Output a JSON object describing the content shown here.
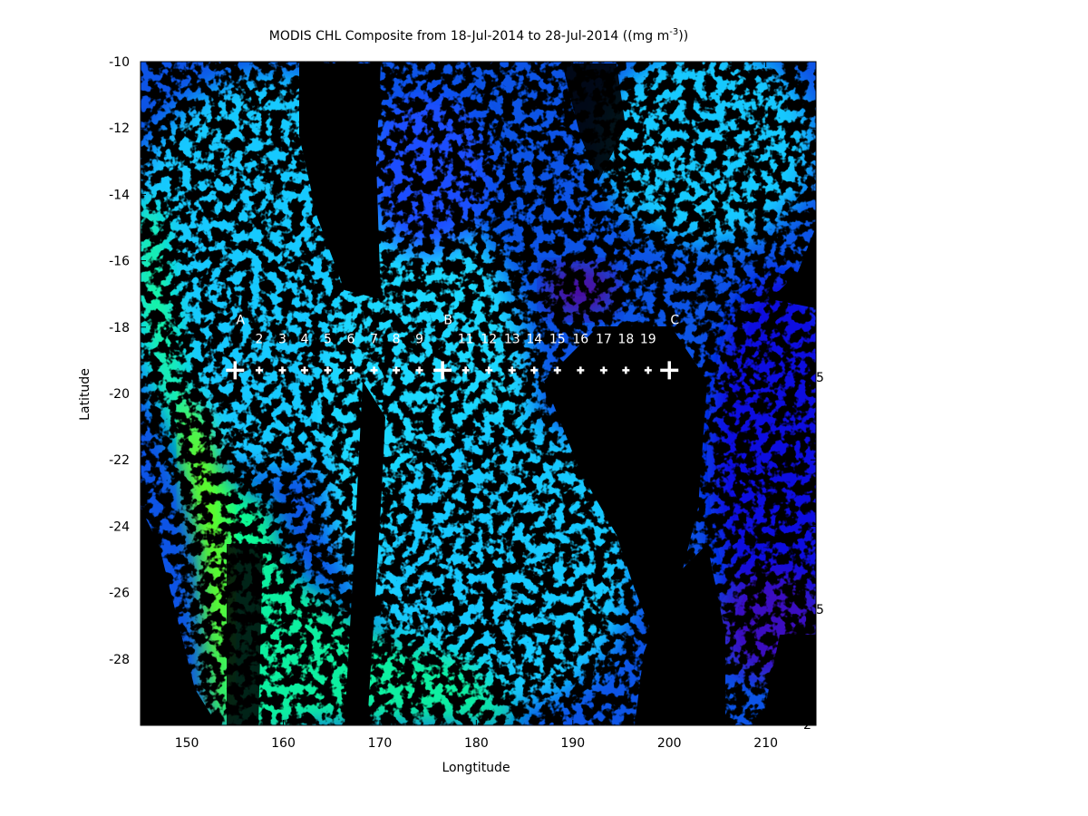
{
  "chart_data": {
    "type": "heatmap",
    "title_main": "MODIS CHL Composite from 18-Jul-2014 to 28-Jul-2014 ((mg m",
    "title_sup": "-3",
    "title_end": "))",
    "xlabel": "Longtitude",
    "ylabel": "Latitude",
    "xlim": [
      145.2,
      215.2
    ],
    "ylim": [
      -30,
      -10
    ],
    "xticks": [
      150,
      160,
      170,
      180,
      190,
      200,
      210
    ],
    "yticks": [
      -10,
      -12,
      -14,
      -16,
      -18,
      -20,
      -22,
      -24,
      -26,
      -28
    ],
    "colorbar_fragments": [
      "5",
      "5",
      "2"
    ],
    "colors": {
      "land_or_nodata": "#000000",
      "low": "#1010e0",
      "mid_low": "#0a5cff",
      "mid": "#19c9ff",
      "mid_high": "#10ff90",
      "high": "#7cff00",
      "very_high": "#ff3300",
      "very_low": "#6a0f9a",
      "marker": "#ffffff"
    },
    "transect": {
      "latitude": -19.3,
      "major_stations": [
        {
          "label": "A",
          "lon": 155.0
        },
        {
          "label": "B",
          "lon": 176.5
        },
        {
          "label": "C",
          "lon": 200.0
        }
      ],
      "minor_stations": [
        {
          "label": "2",
          "lon": 157.5
        },
        {
          "label": "3",
          "lon": 159.9
        },
        {
          "label": "4",
          "lon": 162.2
        },
        {
          "label": "5",
          "lon": 164.6
        },
        {
          "label": "6",
          "lon": 167.0
        },
        {
          "label": "7",
          "lon": 169.4
        },
        {
          "label": "8",
          "lon": 171.7
        },
        {
          "label": "9",
          "lon": 174.1
        },
        {
          "label": "11",
          "lon": 178.9
        },
        {
          "label": "12",
          "lon": 181.3
        },
        {
          "label": "13",
          "lon": 183.7
        },
        {
          "label": "14",
          "lon": 186.0
        },
        {
          "label": "15",
          "lon": 188.4
        },
        {
          "label": "16",
          "lon": 190.8
        },
        {
          "label": "17",
          "lon": 193.2
        },
        {
          "label": "18",
          "lon": 195.5
        },
        {
          "label": "19",
          "lon": 197.8
        }
      ]
    }
  }
}
